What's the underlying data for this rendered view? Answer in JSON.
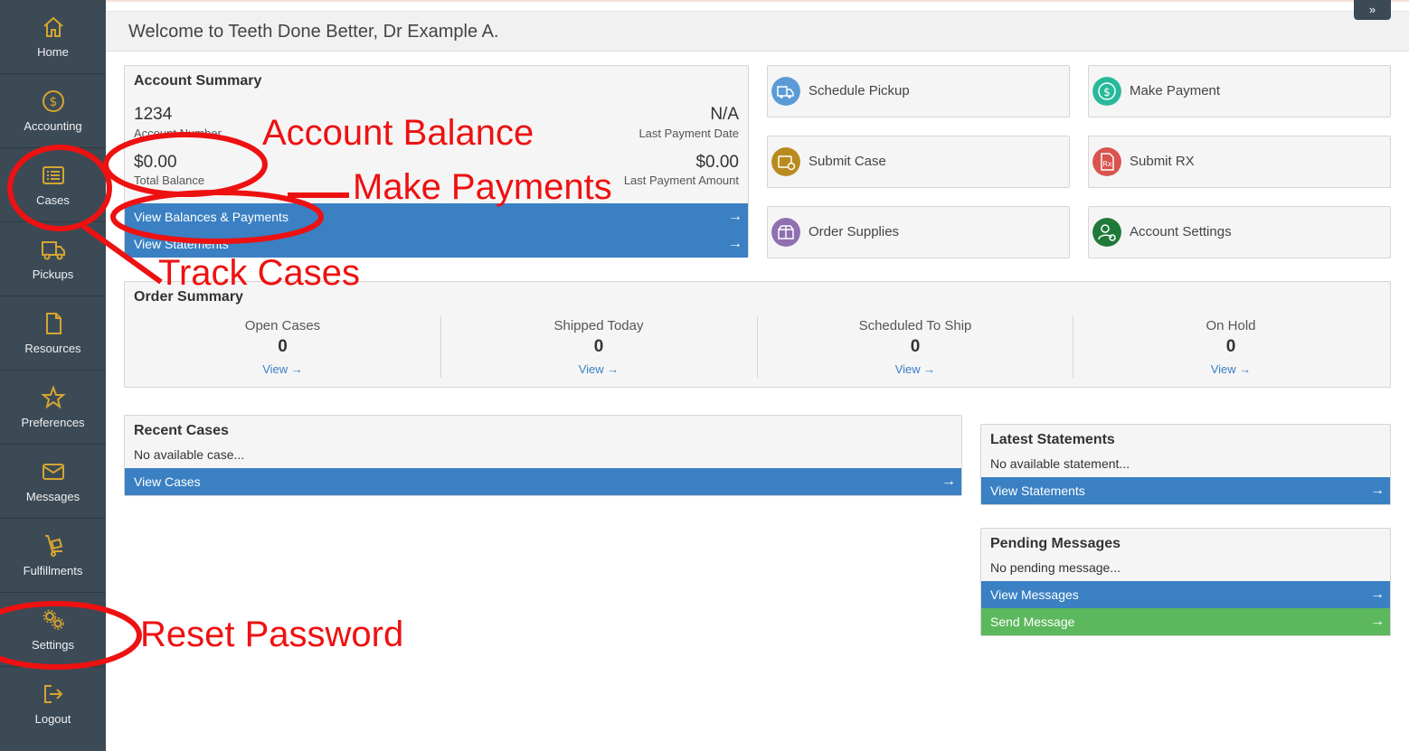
{
  "nav": [
    {
      "label": "Home",
      "icon": "home-icon"
    },
    {
      "label": "Accounting",
      "icon": "dollar-icon"
    },
    {
      "label": "Cases",
      "icon": "list-icon"
    },
    {
      "label": "Pickups",
      "icon": "truck-icon"
    },
    {
      "label": "Resources",
      "icon": "file-icon"
    },
    {
      "label": "Preferences",
      "icon": "star-icon"
    },
    {
      "label": "Messages",
      "icon": "envelope-icon"
    },
    {
      "label": "Fulfillments",
      "icon": "dolly-icon"
    },
    {
      "label": "Settings",
      "icon": "gears-icon"
    },
    {
      "label": "Logout",
      "icon": "logout-icon"
    }
  ],
  "header": {
    "title": "Welcome to Teeth Done Better, Dr Example A.",
    "collapse_glyph": "»"
  },
  "account": {
    "title": "Account Summary",
    "account_number": "1234",
    "account_number_label": "Account Number",
    "last_payment": "N/A",
    "last_payment_label": "Last Payment Date",
    "balance": "$0.00",
    "balance_label": "Total Balance",
    "last_amount": "$0.00",
    "last_amount_label": "Last Payment Amount",
    "link1": "View Balances & Payments",
    "link2": "View Statements"
  },
  "tiles": [
    {
      "label": "Schedule Pickup",
      "color": "#5b9bd5",
      "icon": "truck-icon"
    },
    {
      "label": "Make Payment",
      "color": "#28b99a",
      "icon": "dollar-icon"
    },
    {
      "label": "Submit Case",
      "color": "#b98a1e",
      "icon": "case-icon"
    },
    {
      "label": "Submit RX",
      "color": "#d9534f",
      "icon": "rx-icon"
    },
    {
      "label": "Order Supplies",
      "color": "#8e6fb0",
      "icon": "box-icon"
    },
    {
      "label": "Account Settings",
      "color": "#1f7a3a",
      "icon": "user-gear-icon"
    }
  ],
  "order_summary": {
    "title": "Order Summary",
    "cols": [
      {
        "caption": "Open Cases",
        "value": "0",
        "link": "View →"
      },
      {
        "caption": "Shipped Today",
        "value": "0",
        "link": "View →"
      },
      {
        "caption": "Scheduled To Ship",
        "value": "0",
        "link": "View →"
      },
      {
        "caption": "On Hold",
        "value": "0",
        "link": "View →"
      }
    ]
  },
  "recent_cases": {
    "title": "Recent Cases",
    "empty": "No available case...",
    "link": "View Cases"
  },
  "latest_statements": {
    "title": "Latest Statements",
    "empty": "No available statement...",
    "link": "View Statements"
  },
  "pending_messages": {
    "title": "Pending Messages",
    "empty": "No pending message...",
    "link1": "View Messages",
    "link2": "Send Message"
  },
  "arrow": "→",
  "annotations": {
    "balance": "Account Balance",
    "payments": "Make Payments",
    "cases": "Track Cases",
    "password": "Reset Password"
  },
  "colors": {
    "sidebar": "#3c4a55",
    "accent_blue": "#3a80c3",
    "accent_green": "#5cb85c",
    "nav_icon": "#d6a531",
    "annotation": "#ee1111"
  }
}
